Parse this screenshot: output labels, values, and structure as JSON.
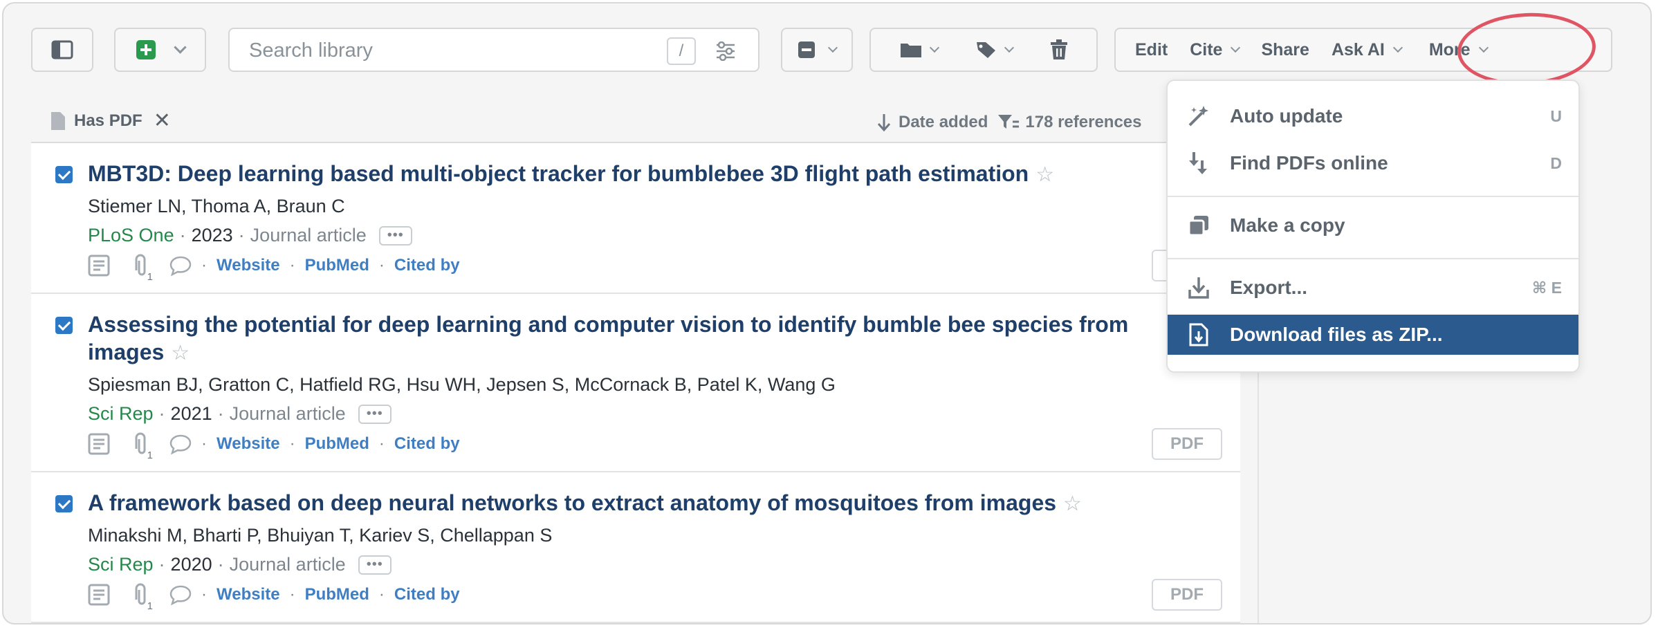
{
  "toolbar": {
    "search_placeholder": "Search library",
    "search_shortcut": "/",
    "edit_label": "Edit",
    "cite_label": "Cite",
    "share_label": "Share",
    "ask_ai_label": "Ask AI",
    "more_label": "More"
  },
  "filter": {
    "chip_label": "Has PDF",
    "sort_label": "Date added",
    "count_label": "178 references"
  },
  "items": [
    {
      "title": "MBT3D: Deep learning based multi-object tracker for bumblebee 3D flight path estimation",
      "authors": "Stiemer LN, Thoma A, Braun C",
      "journal": "PLoS One",
      "year": "2023",
      "type": "Journal article",
      "attachments": "1",
      "links": [
        "Website",
        "PubMed",
        "Cited by"
      ]
    },
    {
      "title": "Assessing the potential for deep learning and computer vision to identify bumble bee species from images",
      "authors": "Spiesman BJ, Gratton C, Hatfield RG, Hsu WH, Jepsen S, McCornack B, Patel K, Wang G",
      "journal": "Sci Rep",
      "year": "2021",
      "type": "Journal article",
      "attachments": "1",
      "links": [
        "Website",
        "PubMed",
        "Cited by"
      ],
      "pdf_label": "PDF"
    },
    {
      "title": "A framework based on deep neural networks to extract anatomy of mosquitoes from images",
      "authors": "Minakshi M, Bharti P, Bhuiyan T, Kariev S, Chellappan S",
      "journal": "Sci Rep",
      "year": "2020",
      "type": "Journal article",
      "attachments": "1",
      "links": [
        "Website",
        "PubMed",
        "Cited by"
      ],
      "pdf_label": "PDF"
    }
  ],
  "menu": {
    "items": [
      {
        "label": "Auto update",
        "shortcut": "U",
        "icon": "magic-wand-icon"
      },
      {
        "label": "Find PDFs online",
        "shortcut": "D",
        "icon": "find-pdf-icon"
      },
      {
        "label": "Make a copy",
        "shortcut": "",
        "icon": "copy-icon"
      },
      {
        "label": "Export...",
        "shortcut": "⌘ E",
        "icon": "export-icon"
      },
      {
        "label": "Download files as ZIP...",
        "shortcut": "",
        "icon": "zip-file-icon"
      }
    ]
  },
  "colors": {
    "accent": "#2b5a8e",
    "title": "#1f3f6b",
    "journal": "#24884b",
    "link": "#3f7ec2",
    "annotation": "#e05564"
  }
}
